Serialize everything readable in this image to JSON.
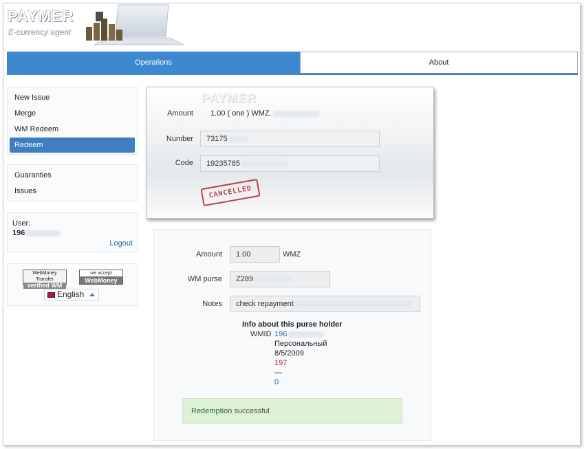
{
  "header": {
    "brand": "PAYMER",
    "subtitle": "E-currency agent"
  },
  "tabs": [
    {
      "label": "Operations",
      "active": true
    },
    {
      "label": "About",
      "active": false
    }
  ],
  "sidebar": {
    "menu_main": [
      {
        "label": "New Issue",
        "active": false
      },
      {
        "label": "Merge",
        "active": false
      },
      {
        "label": "WM Redeem",
        "active": false
      },
      {
        "label": "Redeem",
        "active": true
      }
    ],
    "menu_secondary": [
      {
        "label": "Guaranties"
      },
      {
        "label": "Issues"
      }
    ],
    "user": {
      "label": "User:",
      "value_prefix": "196",
      "logout": "Logout"
    },
    "badges": {
      "wm_transfer_top": "WebMoney Transfer",
      "wm_transfer_bottom": "verified WM",
      "we_accept_top": "we accept",
      "we_accept_bottom": "WebMoney"
    },
    "language": "English"
  },
  "cheque": {
    "brand": "PAYMER",
    "amount_label": "Amount",
    "amount_value": "1.00 ( one ) WMZ.",
    "number_label": "Number",
    "number_value": "73175",
    "code_label": "Code",
    "code_value": "19235785",
    "stamp": "CANCELLED"
  },
  "redeem_form": {
    "amount_label": "Amount",
    "amount_value": "1.00",
    "amount_unit": "WMZ",
    "purse_label": "WM purse",
    "purse_value": "Z289",
    "notes_label": "Notes",
    "notes_value": "check repayment",
    "info_title": "Info about this purse holder",
    "wmid_label": "WMID",
    "wmid_value": "196",
    "passport": "Персональный",
    "reg_date": "8/5/2009",
    "bl": "197",
    "dash": "—",
    "claims": "0",
    "success_message": "Redemption successful"
  },
  "colors": {
    "accent": "#3d88cf",
    "active_menu": "#3d7fc1",
    "success_bg": "#dff0d8",
    "stamp": "#b8303a"
  }
}
